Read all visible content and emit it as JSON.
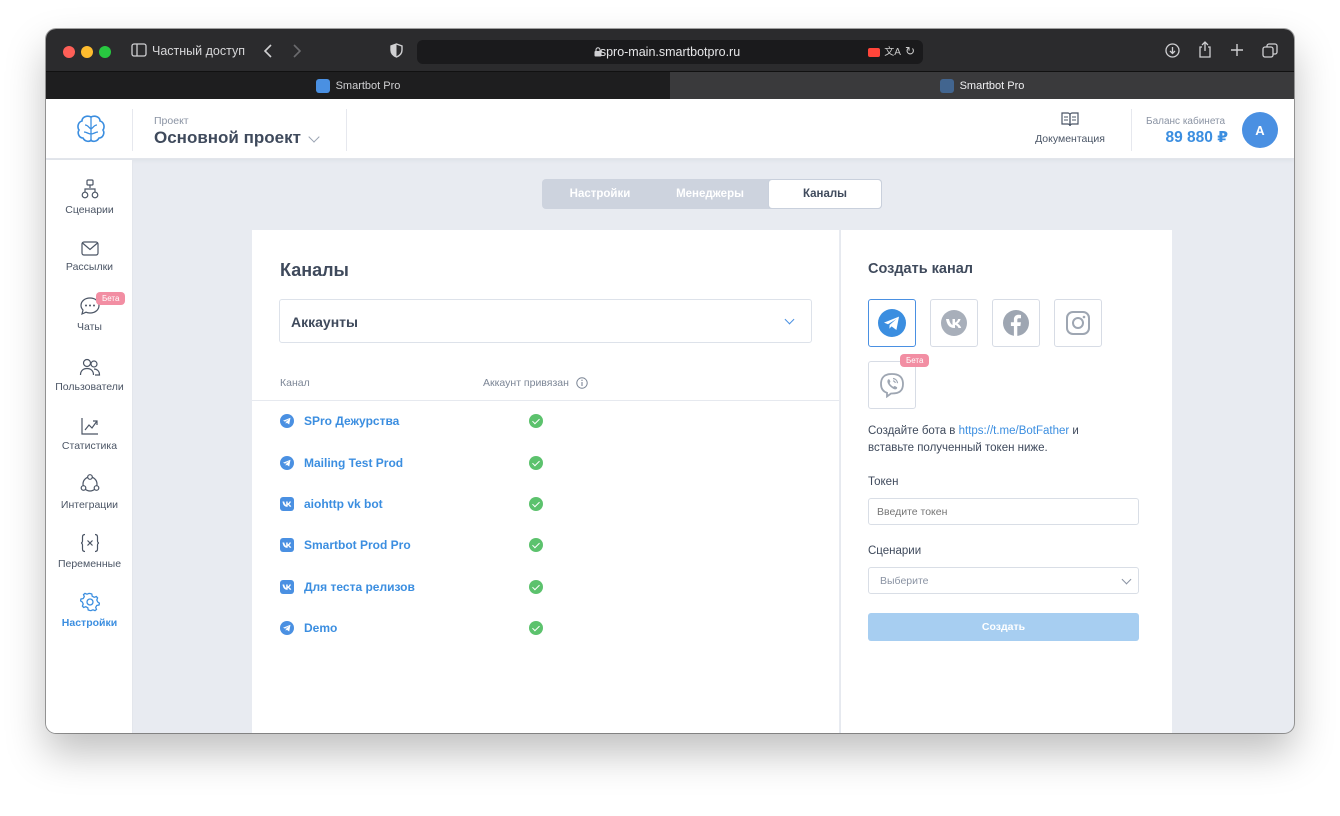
{
  "browser": {
    "private_label": "Частный доступ",
    "url": "spro-main.smartbotpro.ru",
    "tabs": [
      {
        "label": "Smartbot Pro",
        "active": false
      },
      {
        "label": "Smartbot Pro",
        "active": true
      }
    ]
  },
  "header": {
    "project_label": "Проект",
    "project_name": "Основной проект",
    "docs_label": "Документация",
    "balance_label": "Баланс кабинета",
    "balance_value": "89 880 ₽",
    "avatar_letter": "A",
    "accent_color": "#4a90e2"
  },
  "sidebar": {
    "items": [
      {
        "label": "Сценарии",
        "icon": "sitemap-icon"
      },
      {
        "label": "Рассылки",
        "icon": "mail-icon"
      },
      {
        "label": "Чаты",
        "icon": "chat-icon",
        "badge": "Бета"
      },
      {
        "label": "Пользователи",
        "icon": "users-icon"
      },
      {
        "label": "Статистика",
        "icon": "chart-icon"
      },
      {
        "label": "Интеграции",
        "icon": "integrations-icon"
      },
      {
        "label": "Переменные",
        "icon": "variables-icon"
      },
      {
        "label": "Настройки",
        "icon": "gear-icon",
        "active": true
      }
    ]
  },
  "tabs": {
    "settings": "Настройки",
    "managers": "Менеджеры",
    "channels": "Каналы",
    "active": "channels"
  },
  "channels": {
    "title": "Каналы",
    "filter_value": "Аккаунты",
    "columns": {
      "channel": "Канал",
      "linked": "Аккаунт привязан"
    },
    "rows": [
      {
        "name": "SPro Дежурства",
        "type": "telegram",
        "linked": true
      },
      {
        "name": "Mailing Test Prod",
        "type": "telegram",
        "linked": true
      },
      {
        "name": "aiohttp vk bot",
        "type": "vk",
        "linked": true
      },
      {
        "name": "Smartbot Prod Pro",
        "type": "vk",
        "linked": true
      },
      {
        "name": "Для теста релизов",
        "type": "vk",
        "linked": true
      },
      {
        "name": "Demo",
        "type": "telegram",
        "linked": true
      }
    ]
  },
  "create": {
    "title": "Создать канал",
    "channel_types": [
      "telegram",
      "vk",
      "facebook",
      "instagram",
      "viber"
    ],
    "selected": "telegram",
    "viber_badge": "Бета",
    "hint_prefix": "Создайте бота в ",
    "hint_link": "https://t.me/BotFather",
    "hint_suffix": " и вставьте полученный токен ниже.",
    "token_label": "Токен",
    "token_placeholder": "Введите токен",
    "scenario_label": "Сценарии",
    "scenario_placeholder": "Выберите",
    "submit_label": "Создать"
  }
}
